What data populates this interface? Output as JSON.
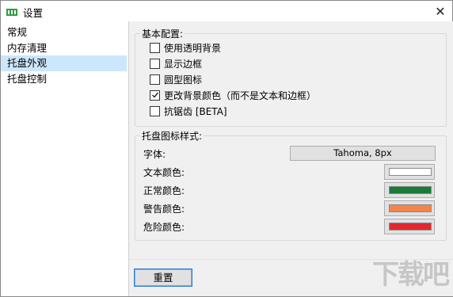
{
  "window": {
    "title": "设置",
    "close_glyph": "✕"
  },
  "sidebar": {
    "items": [
      {
        "label": "常规",
        "selected": false
      },
      {
        "label": "内存清理",
        "selected": false
      },
      {
        "label": "托盘外观",
        "selected": true
      },
      {
        "label": "托盘控制",
        "selected": false
      }
    ]
  },
  "basic": {
    "legend": "基本配置:",
    "options": [
      {
        "label": "使用透明背景",
        "checked": false
      },
      {
        "label": "显示边框",
        "checked": false
      },
      {
        "label": "圆型图标",
        "checked": false
      },
      {
        "label": "更改背景颜色（而不是文本和边框）",
        "checked": true
      },
      {
        "label": "抗锯齿 [BETA]",
        "checked": false
      }
    ]
  },
  "tray_style": {
    "legend": "托盘图标样式:",
    "font_label": "字体:",
    "font_value": "Tahoma, 8px",
    "colors": [
      {
        "label": "文本颜色:",
        "color": "#ffffff"
      },
      {
        "label": "正常颜色:",
        "color": "#1a7a3a"
      },
      {
        "label": "警告颜色:",
        "color": "#f4844c"
      },
      {
        "label": "危险颜色:",
        "color": "#e0282e"
      }
    ]
  },
  "footer": {
    "reset_label": "重置"
  },
  "watermark": "下载吧"
}
